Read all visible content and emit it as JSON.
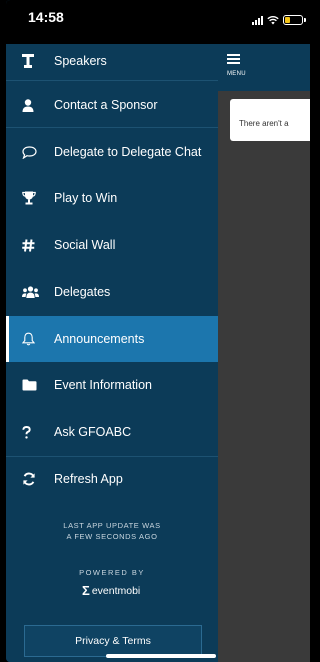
{
  "status_bar": {
    "time": "14:58"
  },
  "sidebar": {
    "items": [
      {
        "label": "Speakers",
        "icon": "speaker-podium-icon"
      },
      {
        "label": "Contact a Sponsor",
        "icon": "person-icon"
      },
      {
        "label": "Delegate to Delegate Chat",
        "icon": "chat-bubble-icon"
      },
      {
        "label": "Play to Win",
        "icon": "trophy-icon"
      },
      {
        "label": "Social Wall",
        "icon": "hashtag-icon"
      },
      {
        "label": "Delegates",
        "icon": "group-icon"
      },
      {
        "label": "Announcements",
        "icon": "bell-icon",
        "active": true
      },
      {
        "label": "Event Information",
        "icon": "folder-icon"
      },
      {
        "label": "Ask GFOABC",
        "icon": "question-icon"
      },
      {
        "label": "Refresh App",
        "icon": "refresh-icon"
      }
    ],
    "last_update_line1": "LAST APP UPDATE WAS",
    "last_update_line2": "A FEW SECONDS AGO",
    "powered_by": "POWERED BY",
    "brand": "eventmobi",
    "privacy_button": "Privacy & Terms"
  },
  "main": {
    "menu_label": "MENU",
    "empty_message": "There aren't a"
  },
  "colors": {
    "sidebar_bg": "#0c3b58",
    "active_item": "#1c76ad",
    "content_bg": "#3a3a3a"
  }
}
